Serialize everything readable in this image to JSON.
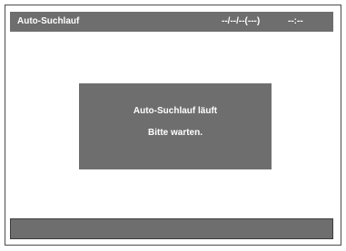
{
  "header": {
    "title": "Auto-Suchlauf",
    "date": "--/--/--(---)",
    "time": "--:--"
  },
  "dialog": {
    "line1": "Auto-Suchlauf läuft",
    "line2": "Bitte warten."
  },
  "colors": {
    "panel": "#6e6e6e",
    "text": "#ffffff",
    "background": "#ffffff"
  }
}
